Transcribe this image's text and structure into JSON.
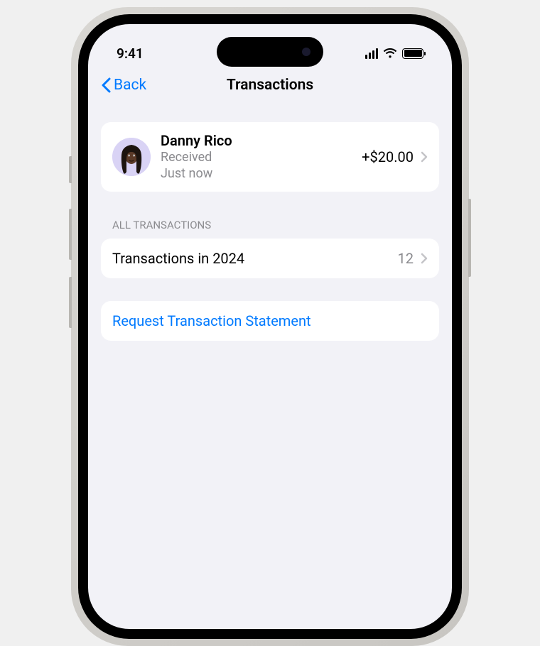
{
  "status": {
    "time": "9:41"
  },
  "nav": {
    "back_label": "Back",
    "title": "Transactions"
  },
  "latest": {
    "name": "Danny Rico",
    "status": "Received",
    "time": "Just now",
    "amount": "+$20.00"
  },
  "sections": {
    "all_header": "ALL TRANSACTIONS",
    "year_label": "Transactions in 2024",
    "year_count": "12"
  },
  "actions": {
    "request_statement": "Request Transaction Statement"
  },
  "colors": {
    "accent": "#007aff"
  }
}
